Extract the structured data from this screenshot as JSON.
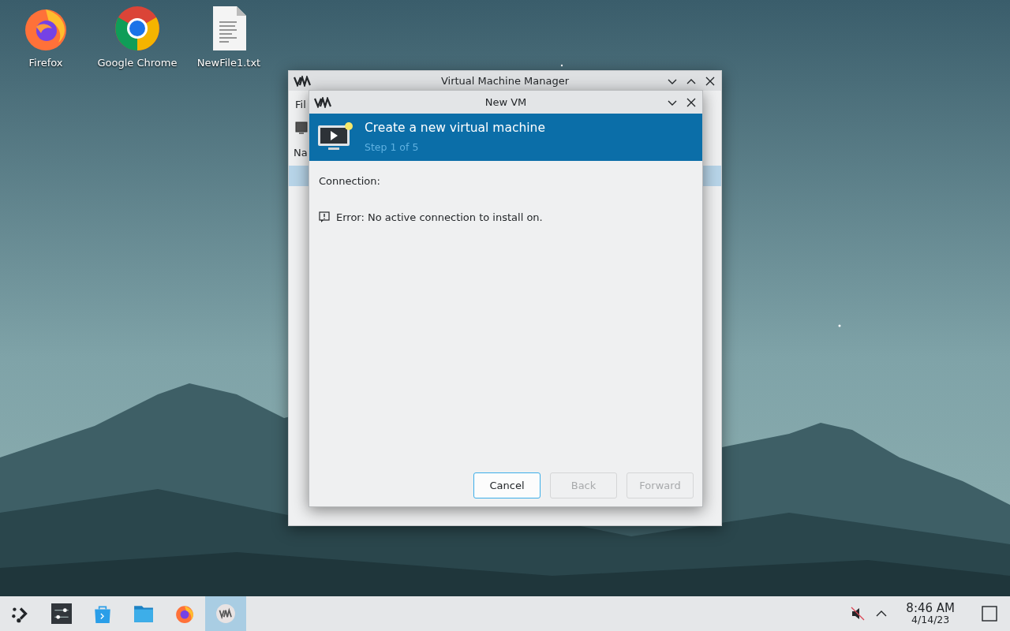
{
  "desktop_icons": [
    {
      "kind": "firefox",
      "label": "Firefox"
    },
    {
      "kind": "chrome",
      "label": "Google Chrome"
    },
    {
      "kind": "textfile",
      "label": "NewFile1.txt"
    }
  ],
  "main_window": {
    "title": "Virtual Machine Manager",
    "menu_text": "Fil",
    "column_header": "Na"
  },
  "dialog": {
    "title": "New VM",
    "heading": "Create a new virtual machine",
    "step": "Step 1 of 5",
    "connection_label": "Connection:",
    "error": "Error: No active connection to install on.",
    "buttons": [
      {
        "label": "Cancel",
        "disabled": false
      },
      {
        "label": "Back",
        "disabled": true
      },
      {
        "label": "Forward",
        "disabled": true
      }
    ]
  },
  "taskbar": {
    "items": [
      {
        "kind": "launcher",
        "selected": false
      },
      {
        "kind": "settings",
        "selected": false
      },
      {
        "kind": "store",
        "selected": false
      },
      {
        "kind": "files",
        "selected": false
      },
      {
        "kind": "firefox",
        "selected": false
      },
      {
        "kind": "vm",
        "selected": true
      }
    ],
    "time": "8:46 AM",
    "date": "4/14/23"
  }
}
